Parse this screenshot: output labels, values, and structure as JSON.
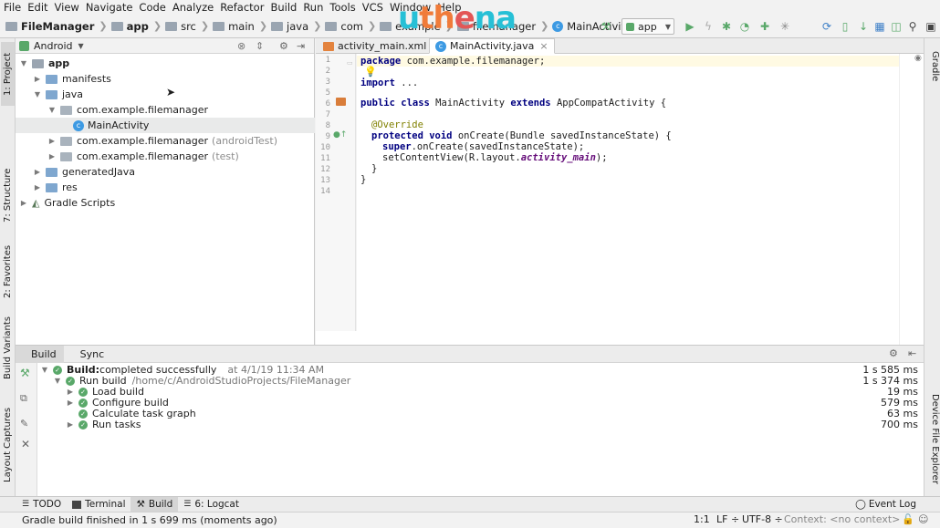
{
  "menu": [
    "File",
    "Edit",
    "View",
    "Navigate",
    "Code",
    "Analyze",
    "Refactor",
    "Build",
    "Run",
    "Tools",
    "VCS",
    "Window",
    "Help"
  ],
  "breadcrumbs": [
    "FileManager",
    "app",
    "src",
    "main",
    "java",
    "com",
    "example",
    "filemanager",
    "MainActivity"
  ],
  "logo": {
    "p1": "u",
    "p2": "th",
    "p3": "e",
    "p4": "na"
  },
  "run_config": "app",
  "left_tabs": {
    "project": "1: Project",
    "structure": "7: Structure",
    "favorites": "2: Favorites",
    "variants": "Build Variants",
    "captures": "Layout Captures"
  },
  "right_tabs": {
    "gradle": "Gradle",
    "device": "Device File Explorer"
  },
  "project_view": "Android",
  "tree": {
    "app": "app",
    "manifests": "manifests",
    "java": "java",
    "pkg1": "com.example.filemanager",
    "main_activity": "MainActivity",
    "pkg2": "com.example.filemanager",
    "pkg2_note": "(androidTest)",
    "pkg3": "com.example.filemanager",
    "pkg3_note": "(test)",
    "generated": "generatedJava",
    "res": "res",
    "gradle_scripts": "Gradle Scripts"
  },
  "editor_tabs": [
    "activity_main.xml",
    "MainActivity.java"
  ],
  "code": {
    "l1_kw": "package",
    "l1_rest": " com.example.filemanager;",
    "l3_kw": "import",
    "l3_rest": " ...",
    "l6_kw": "public class",
    "l6_a": " MainActivity ",
    "l6_kw2": "extends",
    "l6_b": " AppCompatActivity {",
    "l8": "@Override",
    "l9_kw": "protected void",
    "l9_rest": " onCreate(Bundle savedInstanceState) {",
    "l10_kw": "super",
    "l10_rest": ".onCreate(savedInstanceState);",
    "l11_a": "setContentView(R.layout.",
    "l11_it": "activity_main",
    "l11_b": ");",
    "l12": "}",
    "l13": "}"
  },
  "line_numbers": [
    "1",
    "2",
    "3",
    "5",
    "6",
    "7",
    "8",
    "9",
    "10",
    "11",
    "12",
    "13",
    "14"
  ],
  "build_tabs": [
    "Build",
    "Sync"
  ],
  "build": {
    "root_label": "Build:",
    "root_text": " completed successfully",
    "root_at": "at 4/1/19 11:34 AM",
    "root_time": "1 s 585 ms",
    "run_label": "Run build",
    "run_path": "/home/c/AndroidStudioProjects/FileManager",
    "run_time": "1 s 374 ms",
    "items": [
      {
        "label": "Load build",
        "time": "19 ms"
      },
      {
        "label": "Configure build",
        "time": "579 ms"
      },
      {
        "label": "Calculate task graph",
        "time": "63 ms"
      },
      {
        "label": "Run tasks",
        "time": "700 ms"
      }
    ]
  },
  "bottom_tools": {
    "todo": "TODO",
    "terminal": "Terminal",
    "build": "Build",
    "logcat": "6: Logcat",
    "event_log": "Event Log"
  },
  "status": {
    "message": "Gradle build finished in 1 s 699 ms (moments ago)",
    "pos": "1:1",
    "lf": "LF ÷",
    "enc": "UTF-8 ÷",
    "context": "Context: <no context>"
  }
}
